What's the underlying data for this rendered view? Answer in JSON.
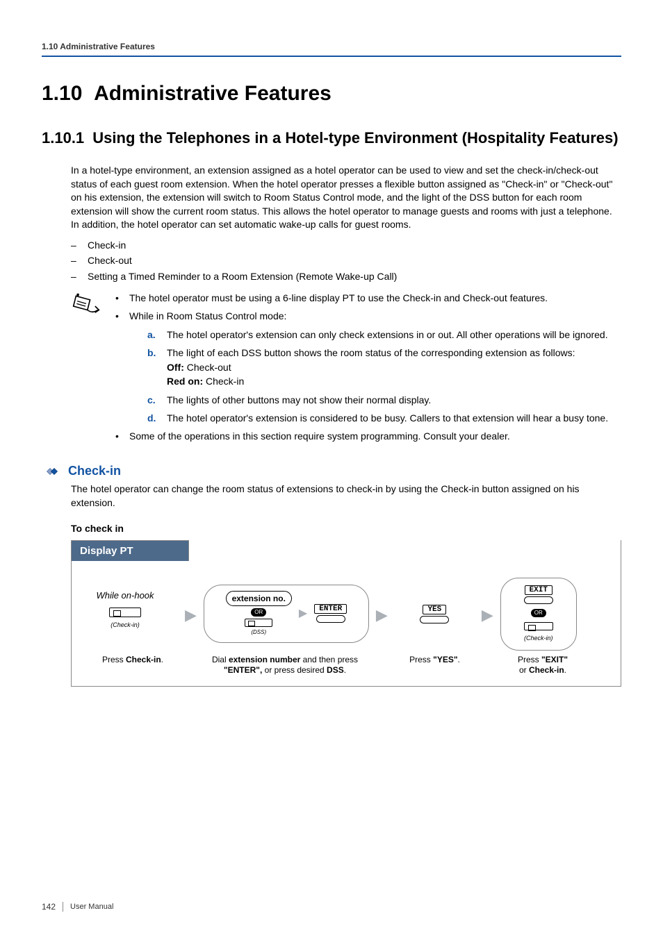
{
  "header": {
    "running": "1.10 Administrative Features"
  },
  "chapter": {
    "num": "1.10",
    "title": "Administrative Features"
  },
  "section": {
    "num": "1.10.1",
    "title": "Using the Telephones in a Hotel-type Environment (Hospitality Features)"
  },
  "intro": "In a hotel-type environment, an extension assigned as a hotel operator can be used to view and set the check-in/check-out status of each guest room extension. When the hotel operator presses a flexible button assigned as \"Check-in\" or \"Check-out\" on his extension, the extension will switch to Room Status Control mode, and the light of the DSS button for each room extension will show the current room status. This allows the hotel operator to manage guests and rooms with just a telephone. In addition, the hotel operator can set automatic wake-up calls for guest rooms.",
  "dashlinks": {
    "a": "Check-in",
    "b": "Check-out",
    "c": "Setting a Timed Reminder to a Room Extension (Remote Wake-up Call)"
  },
  "notes": {
    "b1": "The hotel operator must be using a 6-line display PT to use the Check-in and Check-out features.",
    "b2": "While in Room Status Control mode:",
    "alpha": {
      "a": "The hotel operator's extension can only check extensions in or out. All other operations will be ignored.",
      "b_lead": "The light of each DSS button shows the room status of the corresponding extension as follows:",
      "b_off_label": "Off:",
      "b_off_val": "Check-out",
      "b_red_label": "Red on:",
      "b_red_val": "Check-in",
      "c": "The lights of other buttons may not show their normal display.",
      "d": "The hotel operator's extension is considered to be busy. Callers to that extension will hear a busy tone."
    },
    "b3": "Some of the operations in this section require system programming. Consult your dealer."
  },
  "checkin": {
    "heading": "Check-in",
    "para": "The hotel operator can change the room status of extensions to check-in by using the Check-in button assigned on his extension.",
    "to": "To check in"
  },
  "procedure": {
    "titlebar": "Display PT",
    "onhook": "While on-hook",
    "checkin_cap": "(Check-in)",
    "ext_label": "extension no.",
    "or": "OR",
    "dss_cap": "(DSS)",
    "enter": "ENTER",
    "yes": "YES",
    "exit": "EXIT",
    "checkin_cap2": "(Check-in)",
    "cap1_a": "Press ",
    "cap1_b": "Check-in",
    "cap1_c": ".",
    "cap2_a": "Dial ",
    "cap2_b": "extension number",
    "cap2_c": " and then press ",
    "cap2_d": "\"ENTER\",",
    "cap2_e": " or press desired ",
    "cap2_f": "DSS",
    "cap2_g": ".",
    "cap3_a": "Press ",
    "cap3_b": "\"YES\"",
    "cap3_c": ".",
    "cap4_a": "Press ",
    "cap4_b": "\"EXIT\"",
    "cap4_c": " or ",
    "cap4_d": "Check-in",
    "cap4_e": "."
  },
  "footer": {
    "page": "142",
    "manual": "User Manual"
  }
}
